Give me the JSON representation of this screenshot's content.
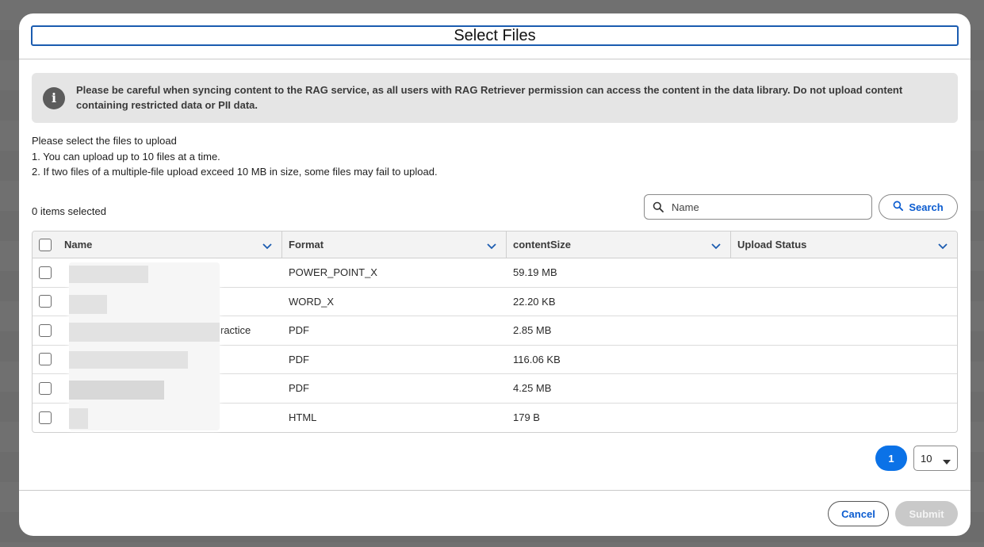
{
  "dialog": {
    "title": "Select Files"
  },
  "notice": {
    "icon": "info-icon",
    "text": "Please be careful when syncing content to the RAG service, as all users with RAG Retriever permission can access the content in the data library. Do not upload content containing restricted data or PII data."
  },
  "instructions": {
    "line1": "Please select the files to upload",
    "line2": "1. You can upload up to 10 files at a time.",
    "line3": "2. If two files of a multiple-file upload exceed 10 MB in size, some files may fail to upload."
  },
  "selection": {
    "count_text": "0 items selected"
  },
  "search": {
    "placeholder": "Name",
    "value": "",
    "button_label": "Search"
  },
  "table": {
    "columns": [
      "Name",
      "Format",
      "contentSize",
      "Upload Status"
    ],
    "rows": [
      {
        "name": "",
        "format": "POWER_POINT_X",
        "size": "59.19 MB",
        "status": ""
      },
      {
        "name": "",
        "format": "WORD_X",
        "size": "22.20 KB",
        "status": ""
      },
      {
        "name": "ractice",
        "format": "PDF",
        "size": "2.85 MB",
        "status": ""
      },
      {
        "name": "",
        "format": "PDF",
        "size": "116.06 KB",
        "status": ""
      },
      {
        "name": "",
        "format": "PDF",
        "size": "4.25 MB",
        "status": ""
      },
      {
        "name": "",
        "format": "HTML",
        "size": "179 B",
        "status": ""
      }
    ]
  },
  "pagination": {
    "current_page": "1",
    "page_size": "10"
  },
  "footer": {
    "cancel_label": "Cancel",
    "submit_label": "Submit"
  },
  "colors": {
    "accent": "#0b72e7",
    "link": "#0b5cd0",
    "title_border": "#1b5cb0",
    "notice_bg": "#e5e5e5",
    "disabled": "#c9c9c9"
  }
}
